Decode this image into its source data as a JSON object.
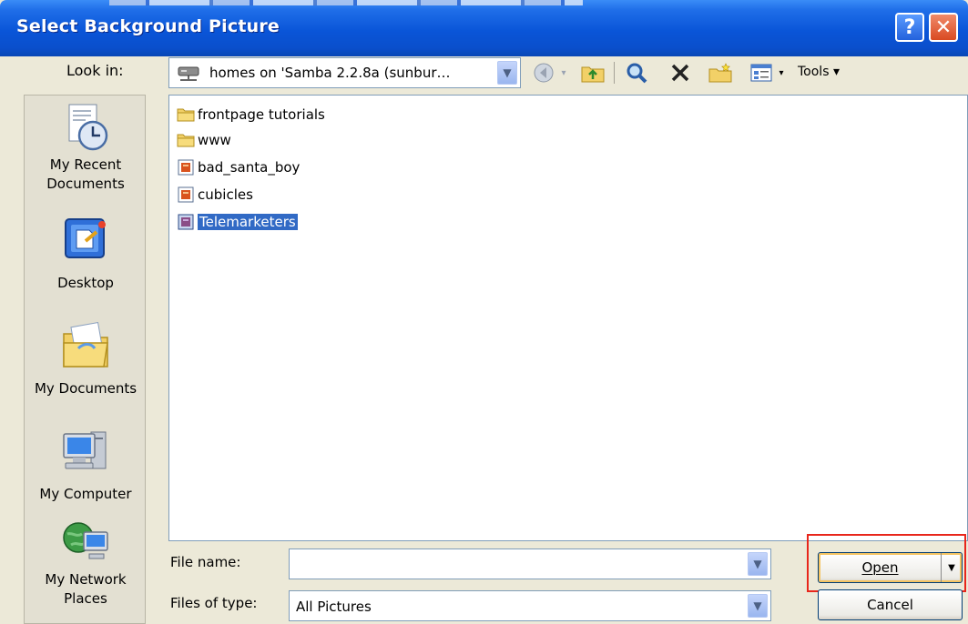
{
  "window": {
    "title": "Select Background Picture",
    "help_glyph": "?",
    "close_glyph": "✕"
  },
  "lookin": {
    "label": "Look in:",
    "value": "homes on 'Samba 2.2.8a (sunbur…",
    "arrow": "▼"
  },
  "toolbar": {
    "tools_label": "Tools ▾"
  },
  "places": [
    {
      "label1": "My Recent",
      "label2": "Documents",
      "icon": "recent-documents-icon"
    },
    {
      "label1": "Desktop",
      "label2": "",
      "icon": "desktop-icon"
    },
    {
      "label1": "My Documents",
      "label2": "",
      "icon": "my-documents-icon"
    },
    {
      "label1": "My Computer",
      "label2": "",
      "icon": "my-computer-icon"
    },
    {
      "label1": "My Network",
      "label2": "Places",
      "icon": "network-places-icon"
    }
  ],
  "files": [
    {
      "name": "frontpage tutorials",
      "type": "folder"
    },
    {
      "name": "www",
      "type": "folder"
    },
    {
      "name": "bad_santa_boy",
      "type": "image"
    },
    {
      "name": "cubicles",
      "type": "image"
    },
    {
      "name": "Telemarketers",
      "type": "image",
      "selected": true
    }
  ],
  "file_name": {
    "label": "File name:",
    "value": ""
  },
  "file_type": {
    "label": "Files of type:",
    "value": "All Pictures"
  },
  "buttons": {
    "open": "Open",
    "cancel": "Cancel"
  },
  "colors": {
    "title_blue": "#0a55d8",
    "selection": "#316ac5",
    "highlight_red": "#e8261b"
  }
}
